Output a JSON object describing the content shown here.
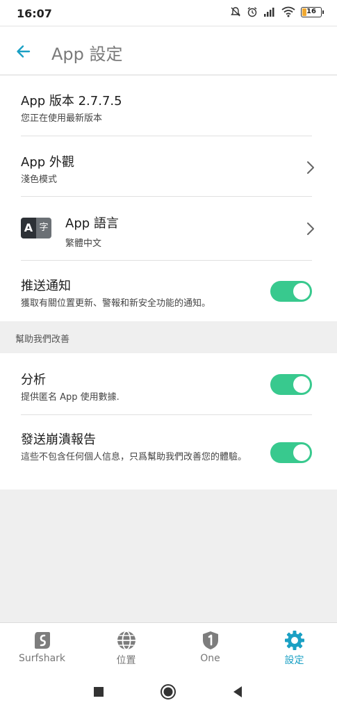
{
  "status_bar": {
    "time": "16:07",
    "battery": "16"
  },
  "app_bar": {
    "title": "App 設定",
    "back_icon": "arrow-left-icon"
  },
  "settings": {
    "version": {
      "title": "App 版本 2.7.7.5",
      "subtitle": "您正在使用最新版本"
    },
    "appearance": {
      "title": "App 外觀",
      "subtitle": "淺色模式"
    },
    "language": {
      "icon_a": "A",
      "icon_z": "字",
      "title": "App 語言",
      "subtitle": "繁體中文"
    },
    "notifications": {
      "title": "推送通知",
      "subtitle": "獲取有關位置更新、警報和新安全功能的通知。",
      "enabled": true
    }
  },
  "section": {
    "label": "幫助我們改善"
  },
  "improve": {
    "analytics": {
      "title": "分析",
      "subtitle": "提供匿名 App 使用數據.",
      "enabled": true
    },
    "crash_reports": {
      "title": "發送崩潰報告",
      "subtitle": "這些不包含任何個人信息，只爲幫助我們改善您的體驗。",
      "enabled": true
    }
  },
  "tabs": [
    {
      "label": "Surfshark",
      "icon": "surfshark-logo-icon",
      "active": false
    },
    {
      "label": "位置",
      "icon": "globe-icon",
      "active": false
    },
    {
      "label": "One",
      "icon": "shield-one-icon",
      "active": false
    },
    {
      "label": "設定",
      "icon": "gear-icon",
      "active": true
    }
  ],
  "colors": {
    "accent": "#1aa0c4",
    "toggle_on": "#38c98e",
    "active_tab": "#1aa0c4"
  }
}
